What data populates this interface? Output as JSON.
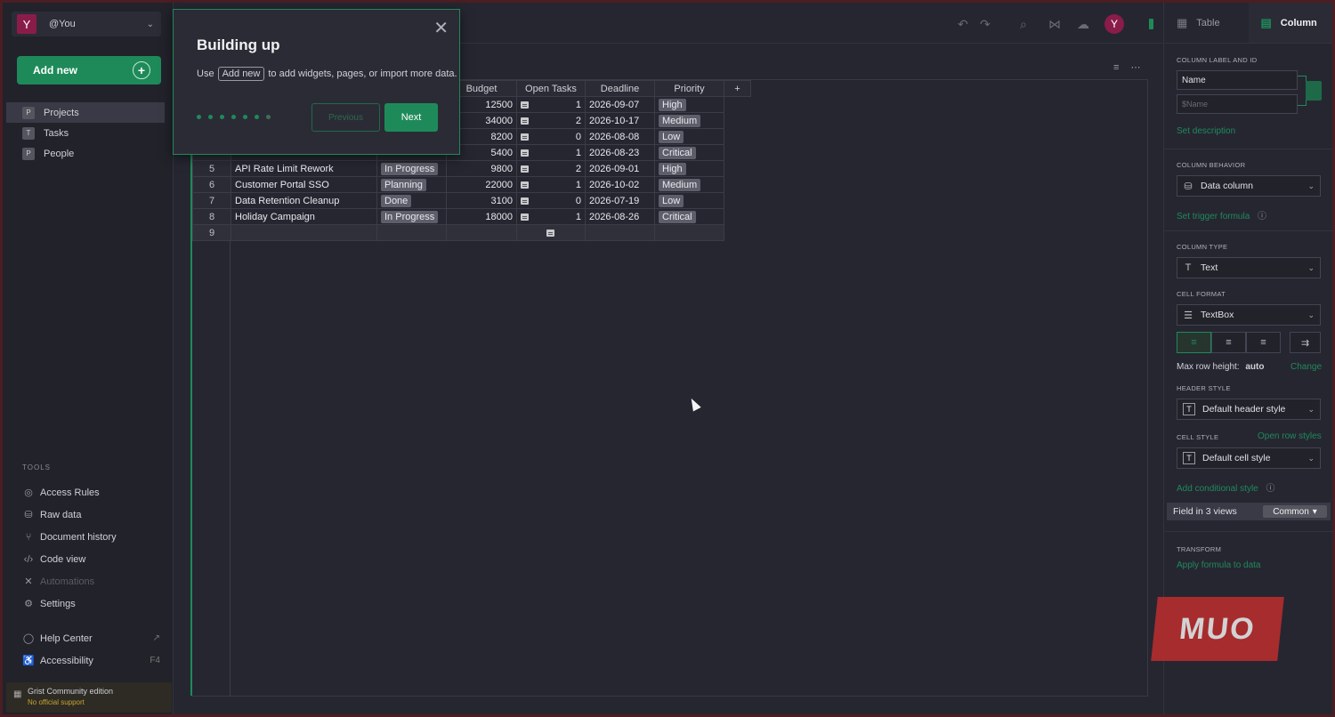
{
  "account": {
    "avatar": "Y",
    "name": "@You"
  },
  "sidebar": {
    "add_new": "Add new",
    "pages": [
      {
        "icon": "P",
        "label": "Projects"
      },
      {
        "icon": "T",
        "label": "Tasks"
      },
      {
        "icon": "P",
        "label": "People"
      }
    ],
    "tools_heading": "TOOLS",
    "tools": [
      {
        "icon": "access-rules-icon",
        "label": "Access Rules"
      },
      {
        "icon": "raw-data-icon",
        "label": "Raw data"
      },
      {
        "icon": "document-history-icon",
        "label": "Document history"
      },
      {
        "icon": "code-view-icon",
        "label": "Code view"
      },
      {
        "icon": "automations-icon",
        "label": "Automations"
      },
      {
        "icon": "settings-icon",
        "label": "Settings"
      }
    ],
    "help": {
      "label": "Help Center"
    },
    "accessibility": {
      "label": "Accessibility",
      "shortcut": "F4"
    },
    "edition": {
      "title": "Grist Community edition",
      "subtitle": "No official support"
    }
  },
  "topbar": {
    "avatar": "Y"
  },
  "popup": {
    "title": "Building up",
    "msg_prefix": "Use",
    "msg_key": "Add new",
    "msg_suffix": "to add widgets, pages, or import more data.",
    "previous": "Previous",
    "next": "Next"
  },
  "grid": {
    "headers": {
      "budget": "Budget",
      "tasks": "Open Tasks",
      "deadline": "Deadline",
      "priority": "Priority",
      "add": "+"
    },
    "rows": [
      {
        "n": "",
        "name": "",
        "status": "",
        "budget": "12500",
        "tasks": "1",
        "deadline": "2026-09-07",
        "priority": "High"
      },
      {
        "n": "",
        "name": "",
        "status": "",
        "budget": "34000",
        "tasks": "2",
        "deadline": "2026-10-17",
        "priority": "Medium"
      },
      {
        "n": "",
        "name": "",
        "status": "",
        "budget": "8200",
        "tasks": "0",
        "deadline": "2026-08-08",
        "priority": "Low"
      },
      {
        "n": "",
        "name": "",
        "status": "",
        "budget": "5400",
        "tasks": "1",
        "deadline": "2026-08-23",
        "priority": "Critical"
      },
      {
        "n": "5",
        "name": "API Rate Limit Rework",
        "status": "In Progress",
        "budget": "9800",
        "tasks": "2",
        "deadline": "2026-09-01",
        "priority": "High"
      },
      {
        "n": "6",
        "name": "Customer Portal SSO",
        "status": "Planning",
        "budget": "22000",
        "tasks": "1",
        "deadline": "2026-10-02",
        "priority": "Medium"
      },
      {
        "n": "7",
        "name": "Data Retention Cleanup",
        "status": "Done",
        "budget": "3100",
        "tasks": "0",
        "deadline": "2026-07-19",
        "priority": "Low"
      },
      {
        "n": "8",
        "name": "Holiday Campaign",
        "status": "In Progress",
        "budget": "18000",
        "tasks": "1",
        "deadline": "2026-08-26",
        "priority": "Critical"
      }
    ],
    "new_row": "9"
  },
  "panel": {
    "tabs": {
      "table": "Table",
      "column": "Column"
    },
    "label_heading": "COLUMN LABEL AND ID",
    "label_value": "Name",
    "id_value": "$Name",
    "set_description": "Set description",
    "behavior_heading": "COLUMN BEHAVIOR",
    "behavior_value": "Data column",
    "set_trigger": "Set trigger formula",
    "type_heading": "COLUMN TYPE",
    "type_value": "Text",
    "format_heading": "CELL FORMAT",
    "format_value": "TextBox",
    "max_row_label": "Max row height:",
    "max_row_value": "auto",
    "change": "Change",
    "header_style_heading": "HEADER STYLE",
    "header_style_value": "Default header style",
    "cell_style_heading": "CELL STYLE",
    "open_row_styles": "Open row styles",
    "cell_style_value": "Default cell style",
    "add_conditional": "Add conditional style",
    "field_in_views": "Field in 3 views",
    "common": "Common",
    "transform_heading": "TRANSFORM",
    "apply_formula": "Apply formula to data"
  },
  "watermark": "MUO"
}
